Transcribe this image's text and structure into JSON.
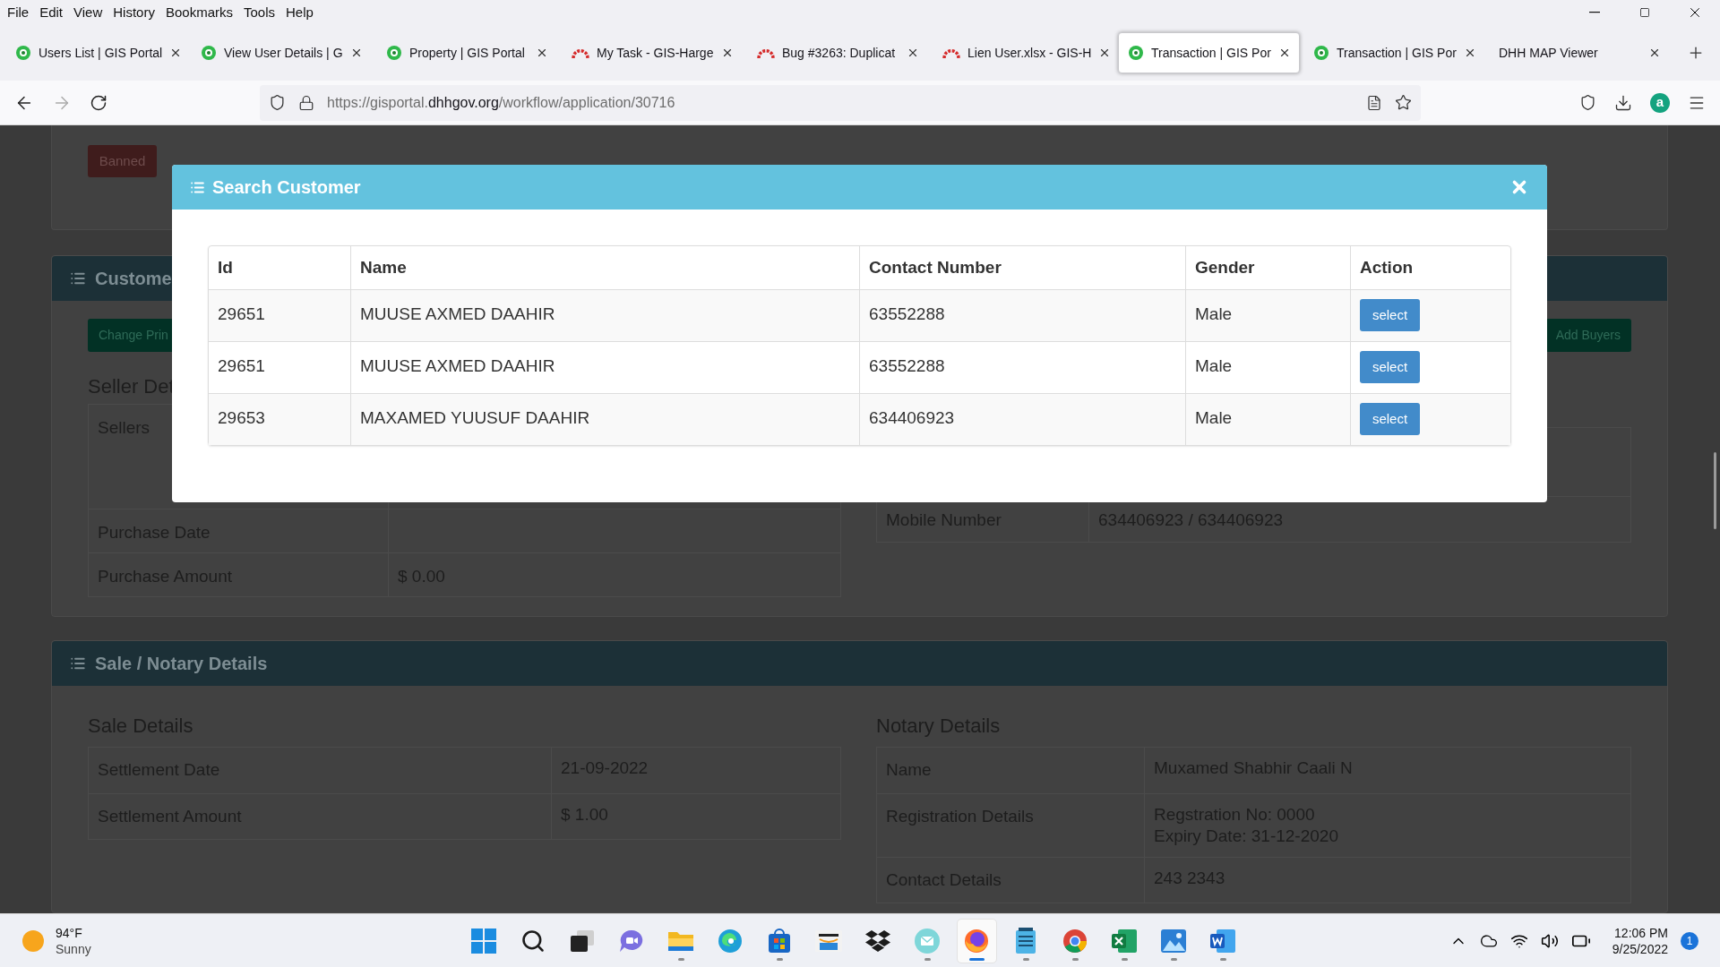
{
  "menu": [
    "File",
    "Edit",
    "View",
    "History",
    "Bookmarks",
    "Tools",
    "Help"
  ],
  "tabs": [
    {
      "title": "Users List | GIS Portal",
      "kind": "gis",
      "selected": false
    },
    {
      "title": "View User Details | G",
      "kind": "gis",
      "selected": false
    },
    {
      "title": "Property | GIS Portal",
      "kind": "gis",
      "selected": false
    },
    {
      "title": "My Task - GIS-Harge",
      "kind": "devops",
      "selected": false
    },
    {
      "title": "Bug #3263: Duplicat",
      "kind": "devops",
      "selected": false
    },
    {
      "title": "Lien User.xlsx - GIS-H",
      "kind": "devops",
      "selected": false
    },
    {
      "title": "Transaction | GIS Por",
      "kind": "gis",
      "selected": true
    },
    {
      "title": "Transaction | GIS Por",
      "kind": "gis",
      "selected": false
    },
    {
      "title": "DHH MAP Viewer",
      "kind": "plain",
      "selected": false
    }
  ],
  "address": {
    "prefix": "https://gisportal.",
    "domain": "dhhgov.org",
    "path": "/workflow/application/30716"
  },
  "account_letter": "a",
  "page": {
    "status_button": "Banned",
    "customer_card": {
      "title": "Custome",
      "change_button": "Change Prin",
      "add_button": "Add Buyers",
      "seller_heading": "Seller Det",
      "seller_rows": [
        {
          "label": "Sellers"
        },
        {
          "label": "Purchase Date"
        },
        {
          "label": "Purchase Amount",
          "value": "$ 0.00"
        }
      ],
      "buyer_rows": [
        {
          "label": "Mobile Number",
          "value": "634406923 / 634406923"
        }
      ]
    },
    "sale_card": {
      "title": "Sale / Notary Details",
      "sale_heading": "Sale Details",
      "sale_rows": [
        {
          "label": "Settlement Date",
          "value": [
            "21-09-2022"
          ]
        },
        {
          "label": "Settlement Amount",
          "value": [
            "$ 1.00"
          ]
        }
      ],
      "notary_heading": "Notary Details",
      "notary_rows": [
        {
          "label": "Name",
          "value": [
            "Muxamed Shabhir Caali N"
          ]
        },
        {
          "label": "Registration Details",
          "value": [
            "Regstration No: 0000",
            "Expiry Date: 31-12-2020"
          ]
        },
        {
          "label": "Contact Details",
          "value": [
            "243 2343"
          ]
        }
      ]
    }
  },
  "modal": {
    "title": "Search Customer",
    "columns": [
      "Id",
      "Name",
      "Contact Number",
      "Gender",
      "Action"
    ],
    "rows": [
      {
        "id": "29651",
        "name": "MUUSE AXMED DAAHIR",
        "contact": "63552288",
        "gender": "Male",
        "action": "select"
      },
      {
        "id": "29651",
        "name": "MUUSE AXMED DAAHIR",
        "contact": "63552288",
        "gender": "Male",
        "action": "select"
      },
      {
        "id": "29653",
        "name": "MAXAMED YUUSUF DAAHIR",
        "contact": "634406923",
        "gender": "Male",
        "action": "select"
      }
    ]
  },
  "taskbar": {
    "weather": {
      "temp": "94°F",
      "condition": "Sunny"
    },
    "apps": [
      {
        "kind": "start",
        "running": false,
        "active": false
      },
      {
        "kind": "search",
        "running": false,
        "active": false
      },
      {
        "kind": "taskview",
        "running": false,
        "active": false
      },
      {
        "kind": "chat",
        "running": false,
        "active": false
      },
      {
        "kind": "explorer",
        "running": true,
        "active": false
      },
      {
        "kind": "edge",
        "running": false,
        "active": false
      },
      {
        "kind": "store",
        "running": true,
        "active": false
      },
      {
        "kind": "amazon",
        "running": false,
        "active": false
      },
      {
        "kind": "dropbox",
        "running": false,
        "active": false
      },
      {
        "kind": "mail",
        "running": true,
        "active": false
      },
      {
        "kind": "firefox",
        "running": true,
        "active": true
      },
      {
        "kind": "notepad",
        "running": true,
        "active": false
      },
      {
        "kind": "chrome",
        "running": true,
        "active": false
      },
      {
        "kind": "excel",
        "running": true,
        "active": false
      },
      {
        "kind": "photos",
        "running": true,
        "active": false
      },
      {
        "kind": "word",
        "running": true,
        "active": false
      }
    ],
    "time": "12:06 PM",
    "date": "9/25/2022",
    "notifications": "1"
  }
}
